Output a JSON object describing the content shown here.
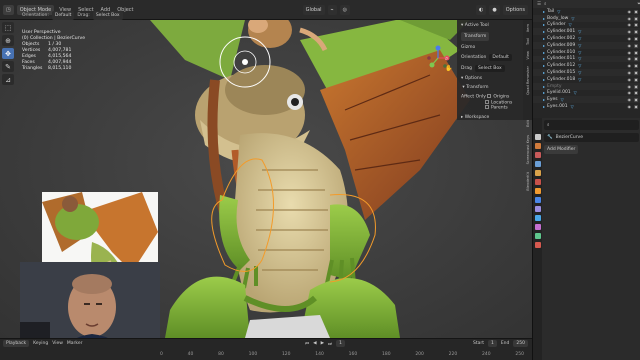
{
  "header": {
    "mode": "Object Mode",
    "menus": [
      "View",
      "Select",
      "Add",
      "Object"
    ],
    "orientation_label": "Orientation:",
    "orientation_value": "Default",
    "drag_label": "Drag:",
    "drag_value": "Select Box",
    "transform_orientation": "Global",
    "options": "Options"
  },
  "stats": {
    "view": "User Perspective",
    "collection": "(0) Collection | BezierCurve",
    "rows": [
      {
        "label": "Objects",
        "value": "1 / 30"
      },
      {
        "label": "Vertices",
        "value": "4,007,781"
      },
      {
        "label": "Edges",
        "value": "4,015,564"
      },
      {
        "label": "Faces",
        "value": "4,007,944"
      },
      {
        "label": "Triangles",
        "value": "8,015,110"
      }
    ]
  },
  "npanel": {
    "active_tool": "Active Tool",
    "tool_name": "Transform",
    "gizmo": "Gizmo",
    "orientation_label": "Orientation",
    "orientation_value": "Default",
    "drag_label": "Drag",
    "drag_value": "Select Box",
    "options": "Options",
    "transform": "Transform",
    "affect_only": "Affect Only",
    "origins": "Origins",
    "locations": "Locations",
    "parents": "Parents",
    "workspace": "Workspace",
    "tabs": [
      "Item",
      "Tool",
      "View",
      "Quad Remesher",
      "Edit",
      "Screencast Keys",
      "BlenderKit"
    ]
  },
  "timeline": {
    "playback": "Playback",
    "keying": "Keying",
    "view": "View",
    "marker": "Marker",
    "start_label": "Start",
    "start_value": "1",
    "end_label": "End",
    "end_value": "250",
    "current": "1",
    "ticks": [
      "0",
      "40",
      "80",
      "100",
      "120",
      "140",
      "160",
      "180",
      "200",
      "220",
      "240",
      "250"
    ]
  },
  "outliner": {
    "items": [
      {
        "name": "Tail",
        "mod": true
      },
      {
        "name": "Body_low",
        "mod": true
      },
      {
        "name": "Cylinder",
        "mod": true
      },
      {
        "name": "Cylinder.001",
        "mod": true
      },
      {
        "name": "Cylinder.002",
        "mod": true
      },
      {
        "name": "Cylinder.009",
        "mod": true
      },
      {
        "name": "Cylinder.010",
        "mod": true
      },
      {
        "name": "Cylinder.011",
        "mod": true
      },
      {
        "name": "Cylinder.012",
        "mod": true
      },
      {
        "name": "Cylinder.015",
        "mod": true
      },
      {
        "name": "Cylinder.018",
        "mod": true
      },
      {
        "name": "Empty",
        "mod": false
      },
      {
        "name": "Eyelid.001",
        "mod": true
      },
      {
        "name": "Eyes",
        "mod": true
      },
      {
        "name": "Eyes.001",
        "mod": true
      }
    ]
  },
  "properties": {
    "object_name": "BezierCurve",
    "add_modifier": "Add Modifier"
  },
  "colors": {
    "accent": "#4772b3",
    "dragon_green": "#7fb23a",
    "wing_orange": "#b0582a",
    "selection_orange": "#f39b2a"
  }
}
